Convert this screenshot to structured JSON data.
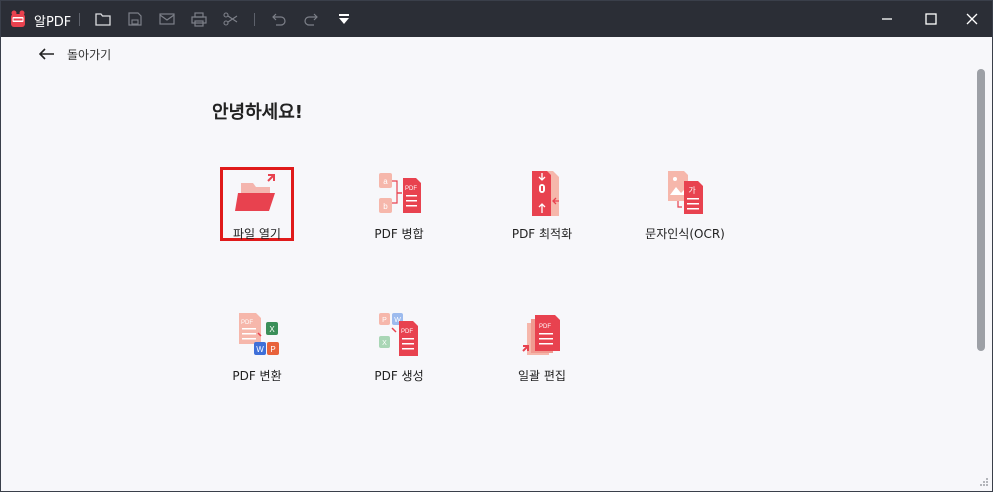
{
  "window": {
    "title": "알PDF"
  },
  "toolbar": {
    "icons": [
      "folder-icon",
      "save-icon",
      "mail-icon",
      "print-icon",
      "share-icon",
      "undo-icon",
      "redo-icon",
      "dropdown-menu-icon"
    ]
  },
  "nav": {
    "back_label": "돌아가기"
  },
  "main": {
    "greeting": "안녕하세요!",
    "tools": [
      {
        "label": "파일 열기",
        "icon": "open-file-icon"
      },
      {
        "label": "PDF 병합",
        "icon": "merge-pdf-icon"
      },
      {
        "label": "PDF 최적화",
        "icon": "optimize-pdf-icon"
      },
      {
        "label": "문자인식(OCR)",
        "icon": "ocr-icon"
      },
      {
        "label": "PDF 변환",
        "icon": "convert-pdf-icon"
      },
      {
        "label": "PDF 생성",
        "icon": "create-pdf-icon"
      },
      {
        "label": "일괄 편집",
        "icon": "batch-edit-icon"
      }
    ]
  },
  "colors": {
    "accent": "#e8424f",
    "accent_light": "#f7b7ae",
    "highlight": "#e01a1a",
    "titlebar": "#2b2e36"
  }
}
